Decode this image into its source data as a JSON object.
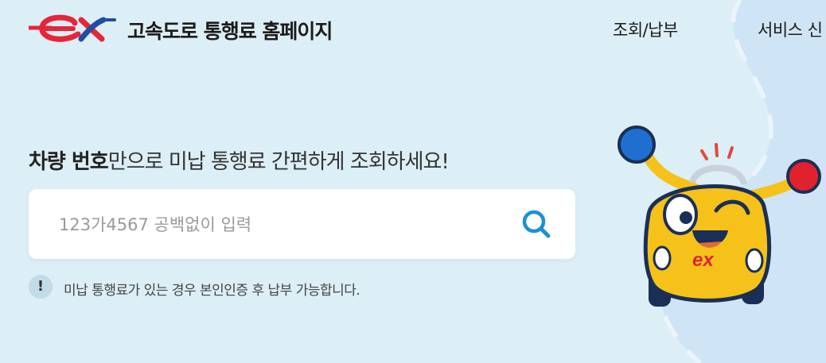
{
  "header": {
    "logo_text": "ex",
    "site_title": "고속도로 통행료 홈페이지",
    "nav": [
      "조회/납부",
      "서비스 신"
    ]
  },
  "main": {
    "headline_strong": "차량 번호",
    "headline_rest": "만으로 미납 통행료 간편하게 조회하세요!",
    "search": {
      "placeholder": "123가4567 공백없이 입력",
      "value": "",
      "button_icon": "search-icon"
    },
    "notice": {
      "icon_glyph": "!",
      "text": "미납 통행료가 있는 경우 본인인증 후 납부 가능합니다."
    }
  },
  "mascot": {
    "icon": "car-mascot-icon",
    "badge_text": "ex"
  },
  "colors": {
    "background": "#dceef6",
    "road": "#cfe4f5",
    "brand_red": "#e5263a",
    "brand_blue": "#1f4ea1",
    "search_icon": "#1a8fd8"
  }
}
